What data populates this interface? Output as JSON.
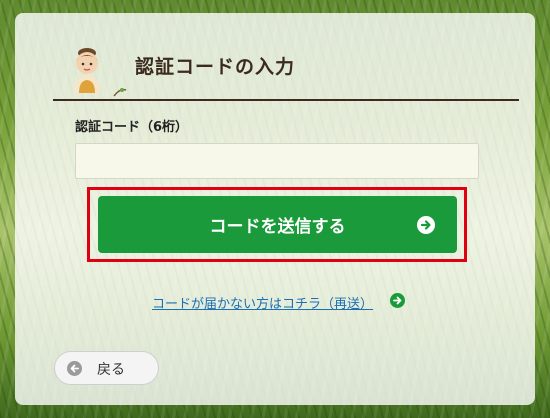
{
  "header": {
    "title": "認証コードの入力"
  },
  "form": {
    "code_label": "認証コード（6桁）",
    "code_value": "",
    "code_placeholder": ""
  },
  "actions": {
    "send_label": "コードを送信する",
    "resend_label": "コードが届かない方はコチラ（再送）",
    "back_label": "戻る"
  },
  "colors": {
    "primary_green": "#1a9a3a",
    "highlight_red": "#e00012",
    "link_blue": "#1a6fb5"
  },
  "icons": {
    "mascot": "mascot-avatar-icon",
    "send": "arrow-circle-right-icon",
    "resend": "arrow-circle-right-icon",
    "back": "arrow-circle-left-icon"
  }
}
